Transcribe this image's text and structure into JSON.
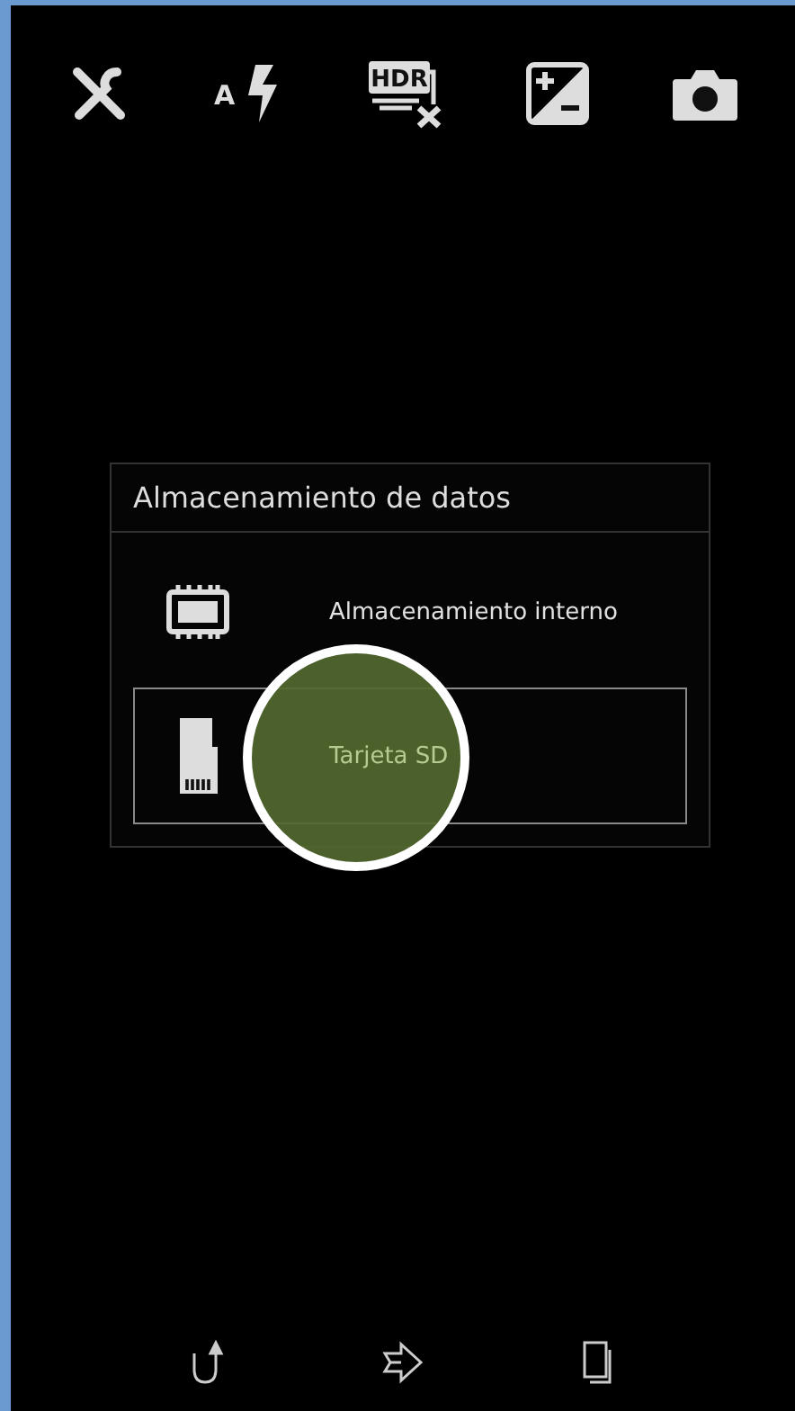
{
  "toolbar": [
    {
      "kind": "settings"
    },
    {
      "kind": "flash",
      "label": "A"
    },
    {
      "kind": "hdr",
      "label": "HDR"
    },
    {
      "kind": "exposure"
    },
    {
      "kind": "camera"
    }
  ],
  "dialog": {
    "title": "Almacenamiento de datos",
    "options": [
      {
        "kind": "internal",
        "label": "Almacenamiento interno",
        "selected": false
      },
      {
        "kind": "sd",
        "label": "Tarjeta SD",
        "selected": true
      }
    ]
  },
  "touch": {
    "kind": "indicator"
  },
  "navbar": [
    {
      "kind": "back"
    },
    {
      "kind": "home"
    },
    {
      "kind": "recent"
    }
  ]
}
